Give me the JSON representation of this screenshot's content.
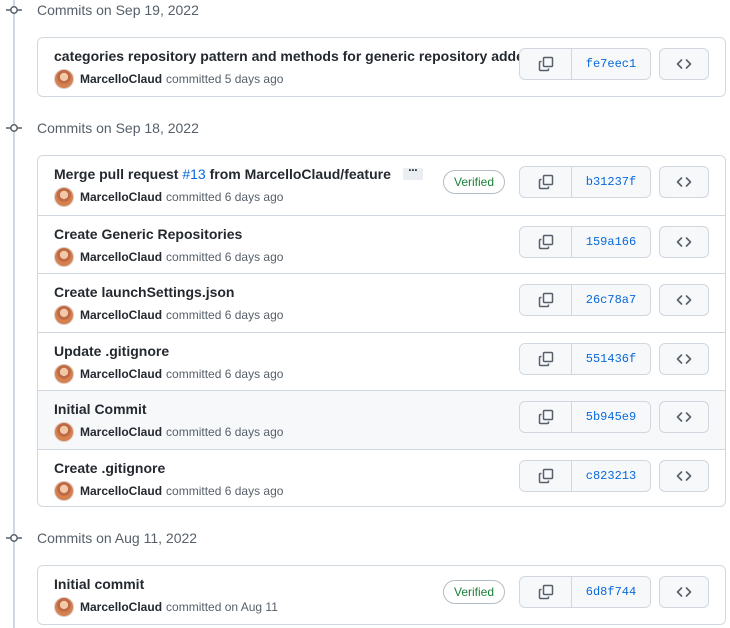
{
  "groups": [
    {
      "title": "Commits on Sep 19, 2022",
      "commits": [
        {
          "message": "categories repository pattern and methods for generic repository added",
          "author": "MarcelloClaud",
          "time": "committed 5 days ago",
          "sha": "fe7eec1",
          "verified": false
        }
      ]
    },
    {
      "title": "Commits on Sep 18, 2022",
      "commits": [
        {
          "message_prefix": "Merge pull request",
          "pr_number": "#13",
          "message_suffix": "from MarcelloClaud/feature",
          "author": "MarcelloClaud",
          "time": "committed 6 days ago",
          "sha": "b31237f",
          "verified": true,
          "verified_label": "Verified"
        },
        {
          "message": "Create Generic Repositories",
          "author": "MarcelloClaud",
          "time": "committed 6 days ago",
          "sha": "159a166",
          "verified": false
        },
        {
          "message": "Create launchSettings.json",
          "author": "MarcelloClaud",
          "time": "committed 6 days ago",
          "sha": "26c78a7",
          "verified": false
        },
        {
          "message": "Update .gitignore",
          "author": "MarcelloClaud",
          "time": "committed 6 days ago",
          "sha": "551436f",
          "verified": false
        },
        {
          "message": "Initial Commit",
          "author": "MarcelloClaud",
          "time": "committed 6 days ago",
          "sha": "5b945e9",
          "verified": false
        },
        {
          "message": "Create .gitignore",
          "author": "MarcelloClaud",
          "time": "committed 6 days ago",
          "sha": "c823213",
          "verified": false
        }
      ]
    },
    {
      "title": "Commits on Aug 11, 2022",
      "commits": [
        {
          "message": "Initial commit",
          "author": "MarcelloClaud",
          "time": "committed on Aug 11",
          "sha": "6d8f744",
          "verified": true,
          "verified_label": "Verified"
        }
      ]
    }
  ],
  "icons": {
    "commit_node": "git-commit-icon",
    "copy": "copy-icon",
    "browse": "code-icon",
    "avatar": "user-avatar"
  },
  "colors": {
    "link": "#0969da",
    "verified": "#1a7f37",
    "border": "#d0d7de",
    "muted": "#57606a"
  }
}
